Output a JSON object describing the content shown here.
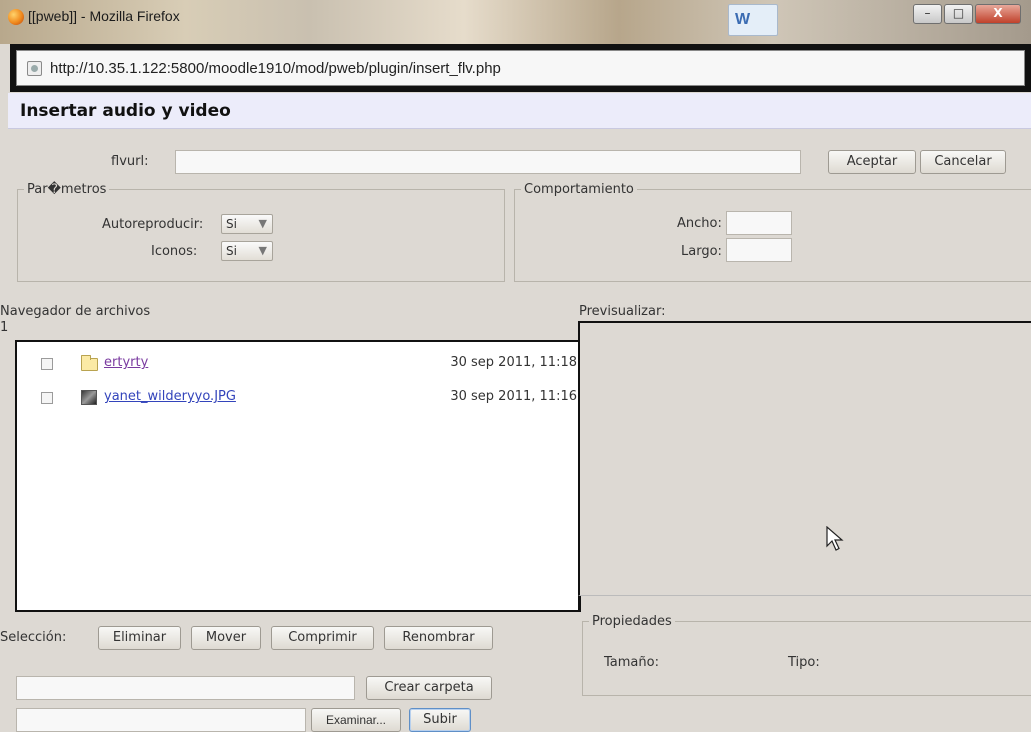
{
  "window": {
    "title": "[[pweb]] - Mozilla Firefox",
    "word_icon": "W",
    "controls": {
      "minimize": "–",
      "maximize": "□",
      "close": "X"
    }
  },
  "address_bar": {
    "url": "http://10.35.1.122:5800/moodle1910/mod/pweb/plugin/insert_flv.php"
  },
  "page": {
    "heading": "Insertar audio y video",
    "flvurl": {
      "label": "flvurl:",
      "value": ""
    },
    "buttons": {
      "accept": "Aceptar",
      "cancel": "Cancelar"
    },
    "parametros": {
      "legend": "Par�metros",
      "autoplay_label": "Autoreproducir:",
      "autoplay_value": "Si",
      "icons_label": "Iconos:",
      "icons_value": "Si"
    },
    "comportamiento": {
      "legend": "Comportamiento",
      "width_label": "Ancho:",
      "width_value": "",
      "height_label": "Largo:",
      "height_value": ""
    },
    "file_browser": {
      "label": "Navegador de archivos",
      "page": "1",
      "files": [
        {
          "name": "ertyrty",
          "date": "30 sep 2011, 11:18",
          "kind": "folder-icon"
        },
        {
          "name": "yanet_wilderyyo.JPG",
          "date": "30 sep 2011, 11:16",
          "kind": "image-icon"
        }
      ]
    },
    "preview": {
      "label": "Previsualizar:"
    },
    "selection": {
      "label": "Selección:",
      "delete": "Eliminar",
      "move": "Mover",
      "compress": "Comprimir",
      "rename": "Renombrar"
    },
    "properties": {
      "legend": "Propiedades",
      "size_label": "Tamaño:",
      "type_label": "Tipo:"
    },
    "create_folder": {
      "value": "",
      "button": "Crear carpeta"
    },
    "upload": {
      "value": "",
      "browse": "Examinar...",
      "submit": "Subir"
    }
  }
}
